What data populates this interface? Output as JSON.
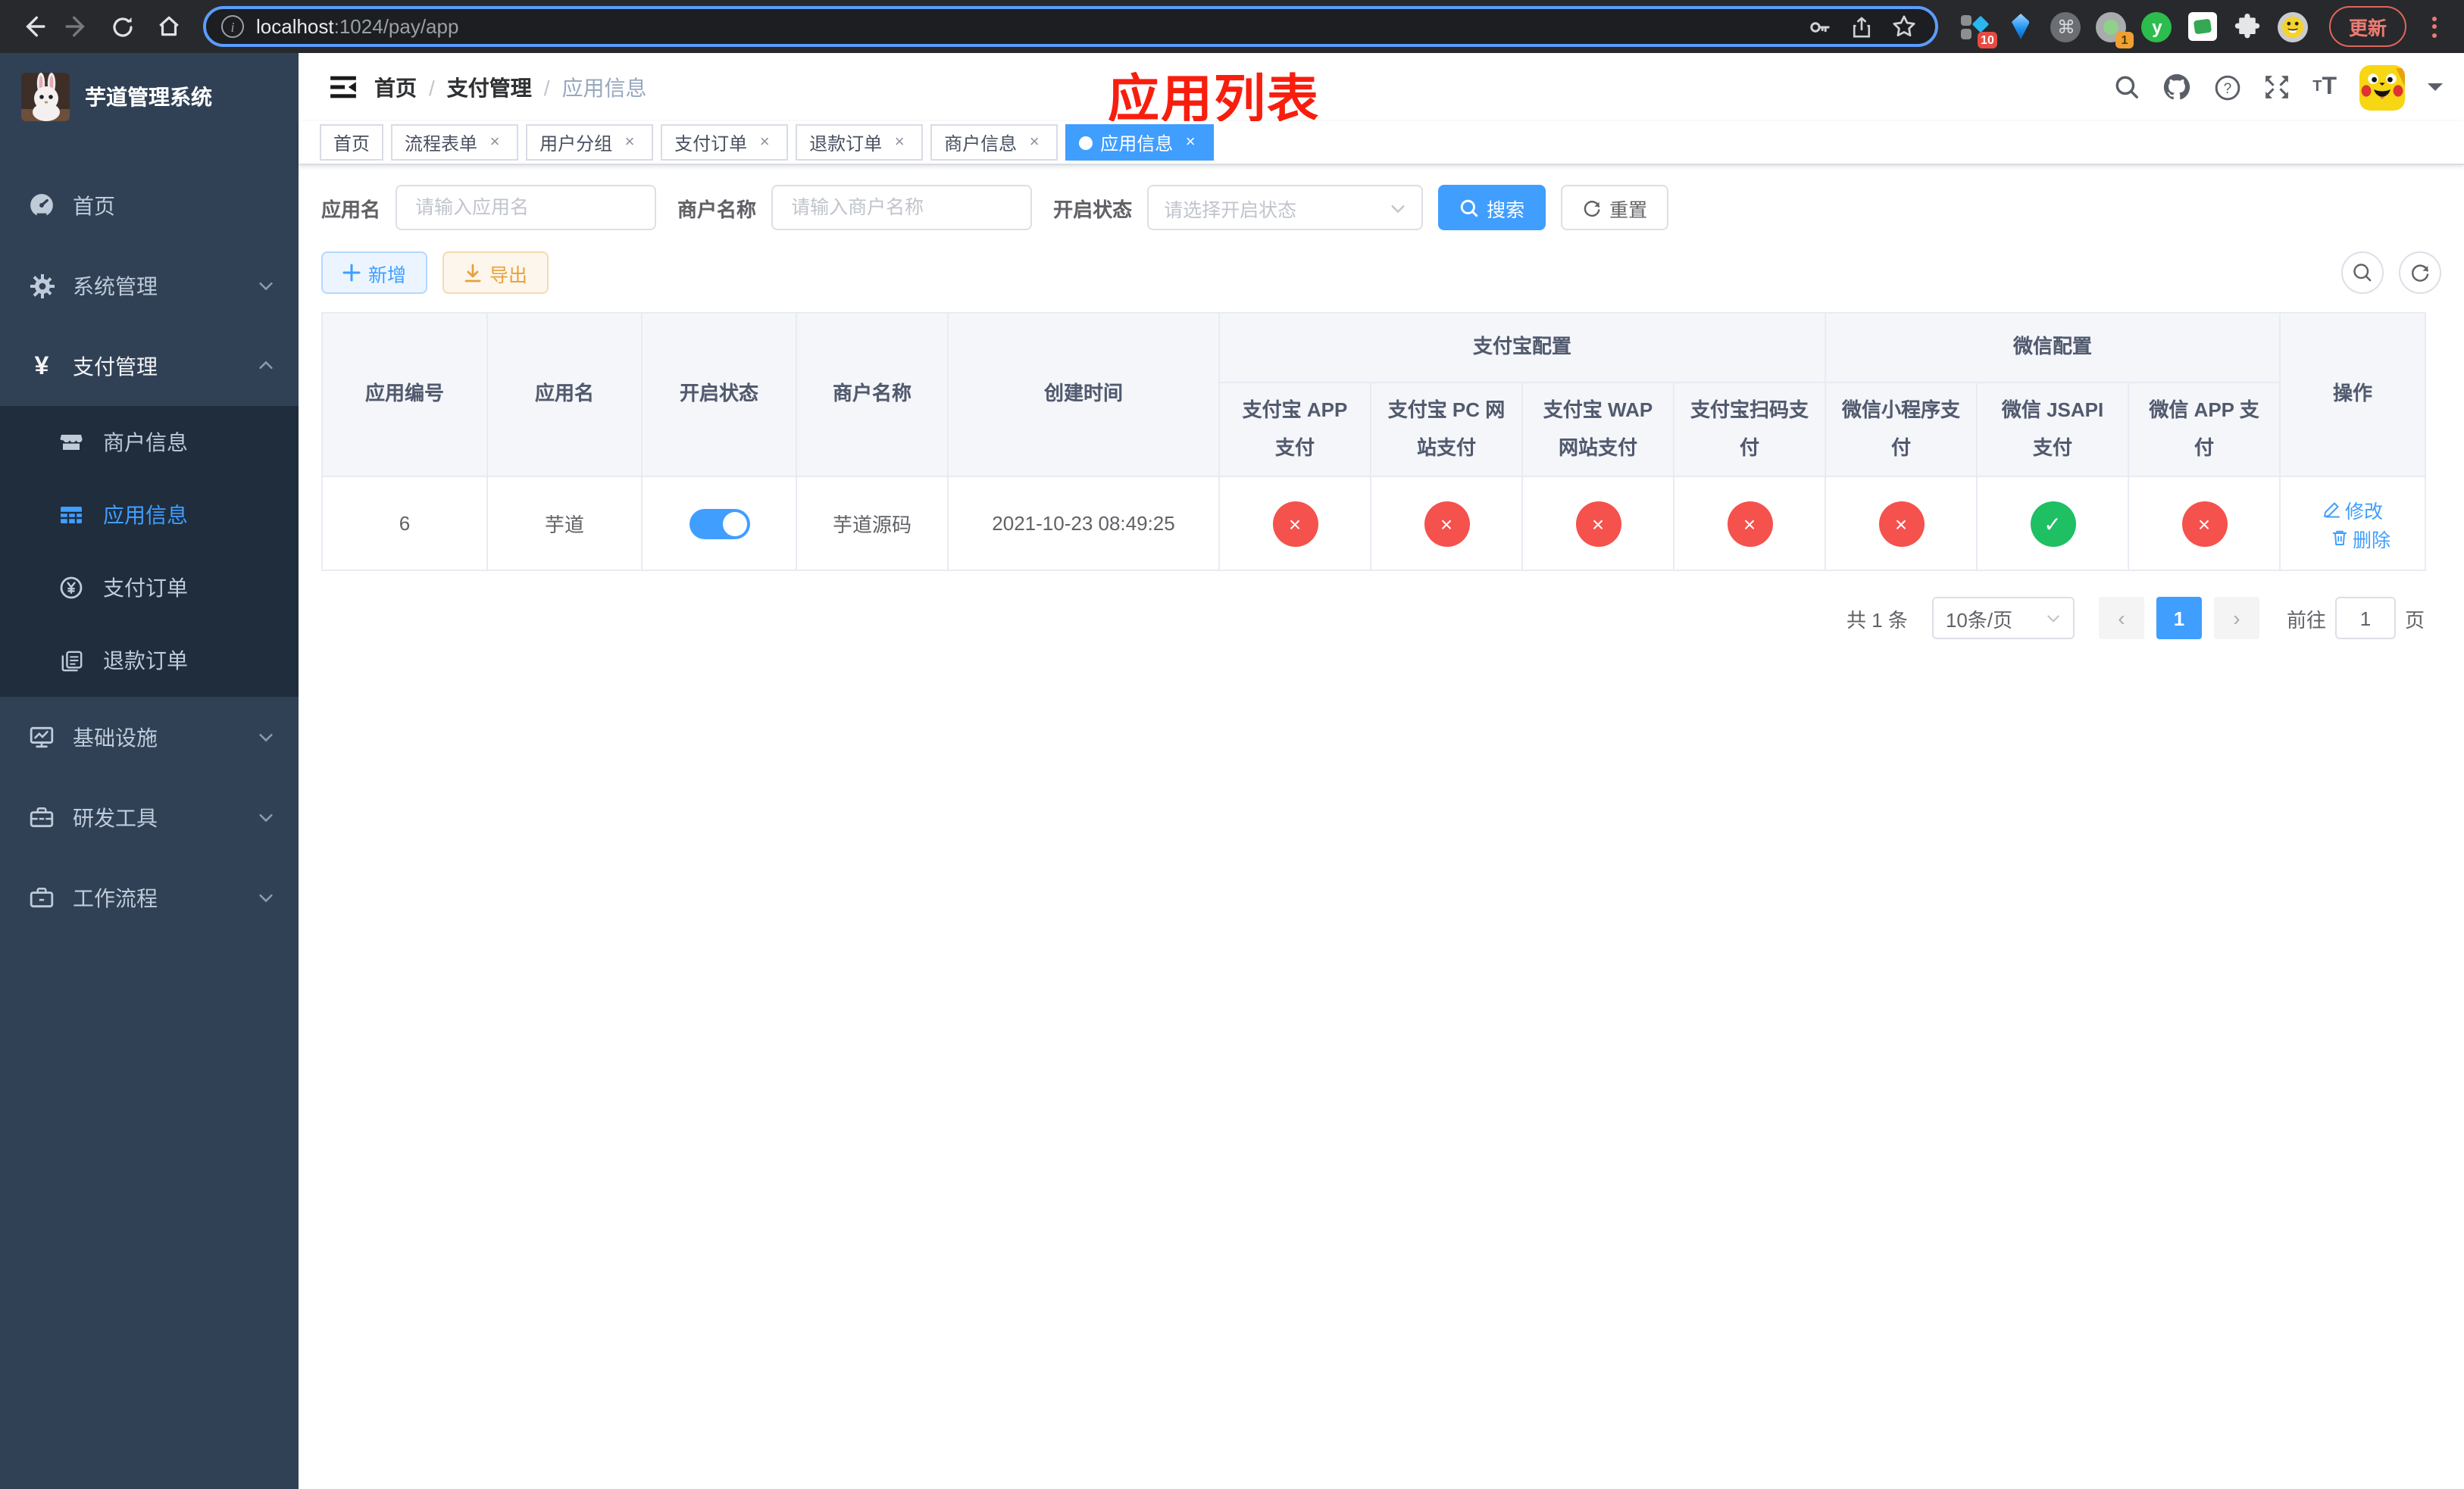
{
  "colors": {
    "accent": "#409eff",
    "success": "#1fbf63",
    "danger": "#f5514d",
    "warning": "#e6a23c",
    "annotation": "#f81e0e"
  },
  "browser": {
    "url_host": "localhost",
    "url_rest": ":1024/pay/app",
    "ext_badge_count": "10",
    "ext_camera_badge": "1",
    "ext_y_label": "y",
    "ext_cmd_glyph": "⌘",
    "update_button": "更新"
  },
  "sidebar": {
    "title": "芋道管理系统",
    "items": [
      {
        "label": "首页"
      },
      {
        "label": "系统管理"
      },
      {
        "label": "支付管理"
      },
      {
        "label": "商户信息"
      },
      {
        "label": "应用信息"
      },
      {
        "label": "支付订单"
      },
      {
        "label": "退款订单"
      },
      {
        "label": "基础设施"
      },
      {
        "label": "研发工具"
      },
      {
        "label": "工作流程"
      }
    ],
    "yen_glyph": "¥"
  },
  "header": {
    "breadcrumb": [
      "首页",
      "支付管理",
      "应用信息"
    ],
    "separator": "/",
    "annotation": "应用列表"
  },
  "tags_bar": {
    "close_glyph": "×",
    "tabs": [
      {
        "label": "首页"
      },
      {
        "label": "流程表单"
      },
      {
        "label": "用户分组"
      },
      {
        "label": "支付订单"
      },
      {
        "label": "退款订单"
      },
      {
        "label": "商户信息"
      },
      {
        "label": "应用信息"
      }
    ]
  },
  "filters": {
    "app_name_label": "应用名",
    "app_name_placeholder": "请输入应用名",
    "merchant_label": "商户名称",
    "merchant_placeholder": "请输入商户名称",
    "status_label": "开启状态",
    "status_placeholder": "请选择开启状态",
    "search_button": "搜索",
    "reset_button": "重置"
  },
  "toolbar": {
    "add_button": "新增",
    "export_button": "导出"
  },
  "table": {
    "check_glyph": "✓",
    "cross_glyph": "×",
    "main_headers": [
      "应用编号",
      "应用名",
      "开启状态",
      "商户名称",
      "创建时间"
    ],
    "group_headers": [
      "支付宝配置",
      "微信配置"
    ],
    "sub_headers": [
      "支付宝 APP 支付",
      "支付宝 PC 网站支付",
      "支付宝 WAP 网站支付",
      "支付宝扫码支付",
      "微信小程序支付",
      "微信 JSAPI 支付",
      "微信 APP 支付"
    ],
    "action_header": "操作",
    "edit_label": "修改",
    "delete_label": "删除",
    "rows": [
      {
        "id": "6",
        "name": "芋道",
        "enabled": true,
        "merchant": "芋道源码",
        "created": "2021-10-23 08:49:25",
        "flags": [
          false,
          false,
          false,
          false,
          false,
          true,
          false
        ]
      }
    ]
  },
  "pagination": {
    "total": "共 1 条",
    "page_size": "10条/页",
    "prev_glyph": "‹",
    "next_glyph": "›",
    "current_page": "1",
    "goto_prefix": "前往",
    "goto_value": "1",
    "goto_suffix": "页"
  }
}
